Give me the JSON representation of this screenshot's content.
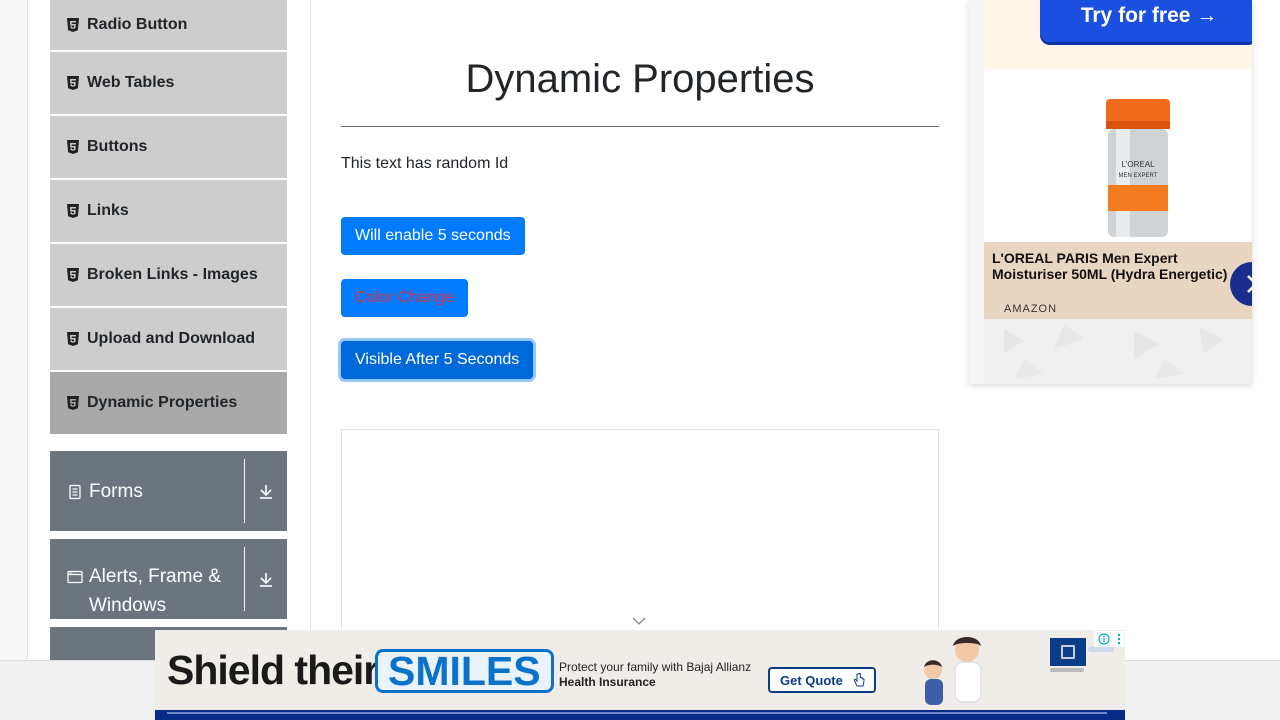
{
  "sidebar": {
    "items": [
      {
        "label": "Radio Button"
      },
      {
        "label": "Web Tables"
      },
      {
        "label": "Buttons"
      },
      {
        "label": "Links"
      },
      {
        "label": "Broken Links - Images"
      },
      {
        "label": "Upload and Download"
      },
      {
        "label": "Dynamic Properties",
        "active": true
      }
    ],
    "groups": [
      {
        "label": "Forms"
      },
      {
        "label_line1": "Alerts, Frame &",
        "label_line2": "Windows"
      }
    ]
  },
  "main": {
    "title": "Dynamic Properties",
    "random_text": "This text has random Id",
    "buttons": {
      "enable_after": "Will enable 5 seconds",
      "color_change": "Color Change",
      "visible_after": "Visible After 5 Seconds"
    }
  },
  "side_ad": {
    "cta": "Try for free →",
    "product_name": "L'OREAL PARIS Men Expert Moisturiser 50ML (Hydra Energetic)",
    "brand": "AMAZON"
  },
  "banner_ad": {
    "headline": "Shield their",
    "highlight": "SMILES",
    "tag_line1": "Protect your family with Bajaj Allianz",
    "tag_line2": "Health Insurance",
    "cta": "Get Quote"
  },
  "colors": {
    "primary": "#007bff",
    "sidebar_item": "#cdcdcd",
    "sidebar_active": "#a9a9a9",
    "group_bg": "#6c757d",
    "danger_text": "#dc3545"
  },
  "icons": {
    "menu_item": "html5-icon",
    "forms": "document-icon",
    "alerts": "window-icon",
    "expand": "download-arrow-icon"
  }
}
